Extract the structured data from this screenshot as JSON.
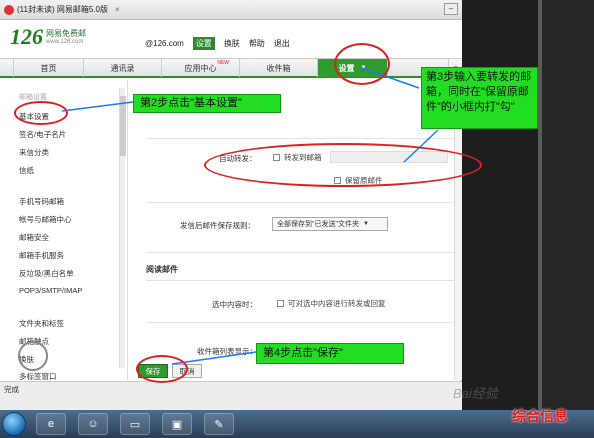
{
  "browser": {
    "tab_title": "(11封未读) 网易邮箱5.0版",
    "status_text": "完成"
  },
  "header": {
    "logo_number": "126",
    "logo_name": "网易免费邮",
    "logo_domain": "www.126.com",
    "user_email": "@126.com",
    "links": [
      "设置",
      "换肤",
      "帮助",
      "退出"
    ]
  },
  "nav": {
    "tabs": [
      "首页",
      "通讯录",
      "应用中心",
      "收件箱",
      "设置"
    ],
    "app_center_badge": "NEW",
    "active_tab": "设置"
  },
  "sidebar": {
    "group_title": "邮箱设置",
    "items": [
      "基本设置",
      "签名/电子名片",
      "来信分类",
      "信纸",
      "手机号码邮箱",
      "帐号与邮箱中心",
      "邮箱安全",
      "邮箱手机服务",
      "反垃圾/黑白名单",
      "POP3/SMTP/IMAP",
      "文件夹和标签",
      "邮箱触点",
      "换肤",
      "多标签窗口"
    ]
  },
  "main": {
    "auto_forward_label": "自动转发：",
    "forward_to_label": "转发到邮箱",
    "keep_original_label": "保留原邮件",
    "save_rule_label": "发信后邮件保存规则：",
    "save_rule_value": "全部保存到\"已发送\"文件夹",
    "reading_section": "阅读邮件",
    "select_content_label": "选中内容时：",
    "select_content_option": "可对选中内容进行转发或回复",
    "inbox_display_label": "收件箱列表显示：",
    "save_button": "保存",
    "cancel_button": "取消"
  },
  "callouts": {
    "step2": "第2步点击\"基本设置\"",
    "step3": "第3步输入要转发的邮箱，同时在\"保留原邮件\"的小框内打\"勾\"",
    "step4": "第4步点击\"保存\""
  },
  "watermarks": {
    "baidu": "Bai经验",
    "brand": "综合信息"
  }
}
